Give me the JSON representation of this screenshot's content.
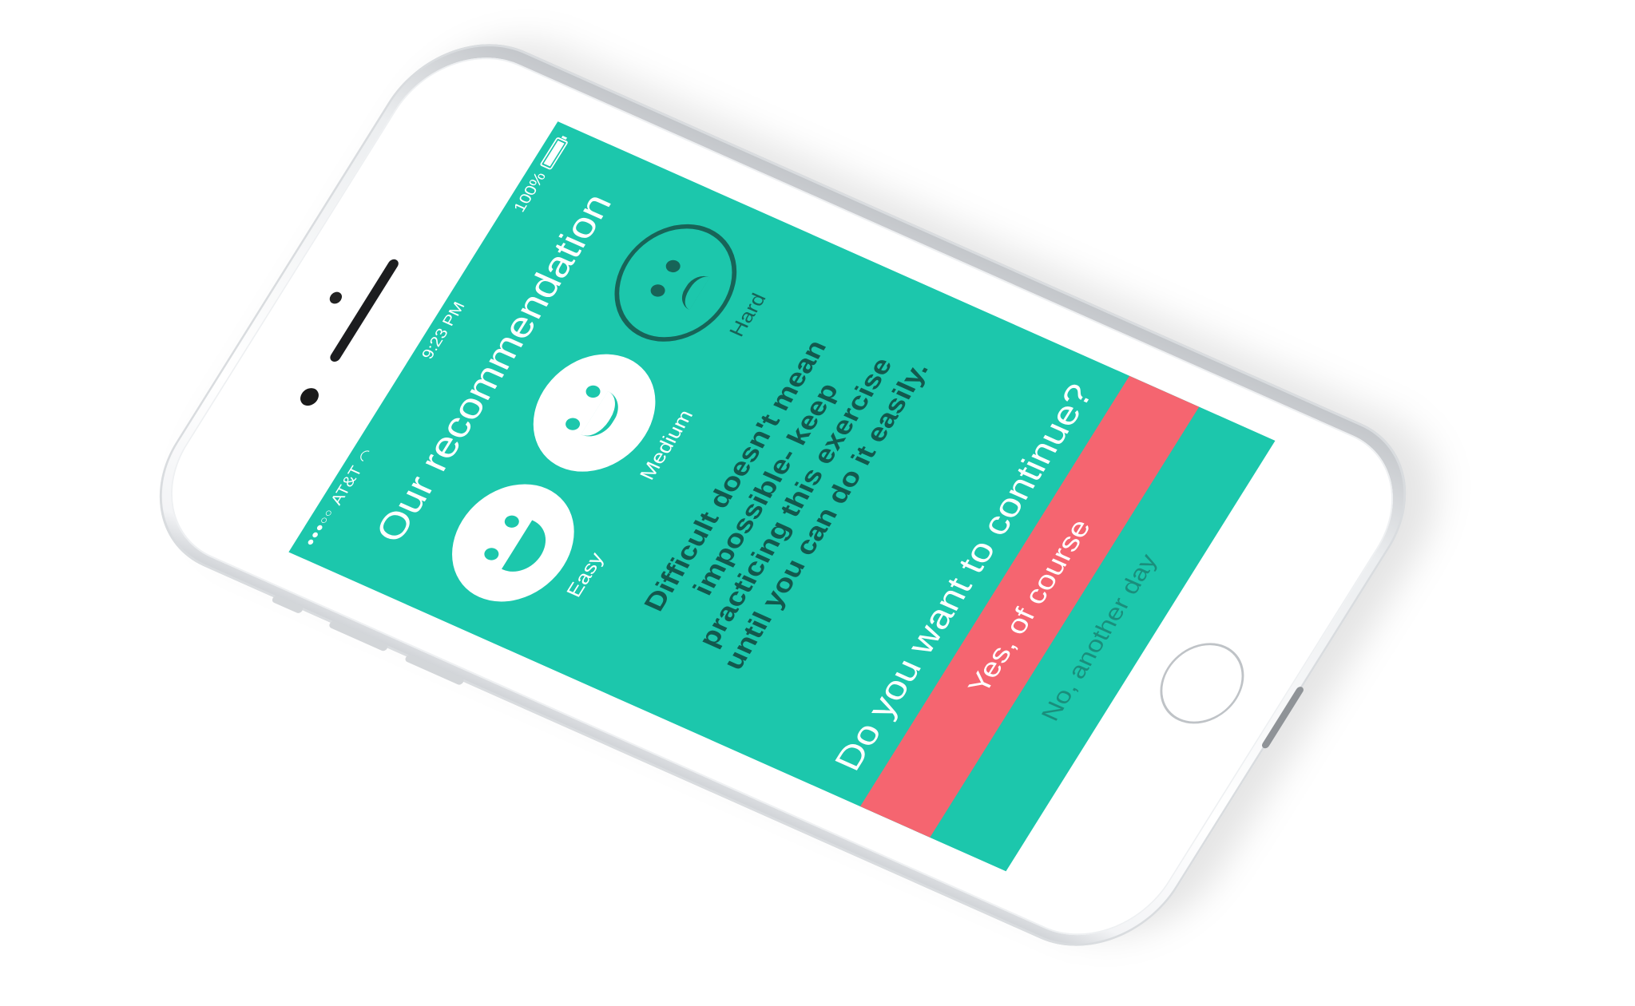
{
  "status_bar": {
    "carrier": "AT&T",
    "signal_dots": "●●●○○",
    "wifi_icon": "wifi-icon",
    "time": "9:23 PM",
    "battery_percent": "100%",
    "battery_level": 1.0
  },
  "screen": {
    "title": "Our recommendation",
    "background_color": "#1cc7ac",
    "difficulty_options": [
      {
        "label": "Easy",
        "icon": "laughing-face-icon",
        "selected": true
      },
      {
        "label": "Medium",
        "icon": "smiling-face-icon",
        "selected": true
      },
      {
        "label": "Hard",
        "icon": "sad-face-icon",
        "selected": false
      }
    ],
    "message": "Difficult doesn't mean impossible- keep practicing this exercise until you can do it easily.",
    "question": "Do you want to continue?",
    "primary_button": {
      "label": "Yes, of course",
      "color": "#f56570"
    },
    "secondary_button": {
      "label": "No, another day"
    }
  }
}
